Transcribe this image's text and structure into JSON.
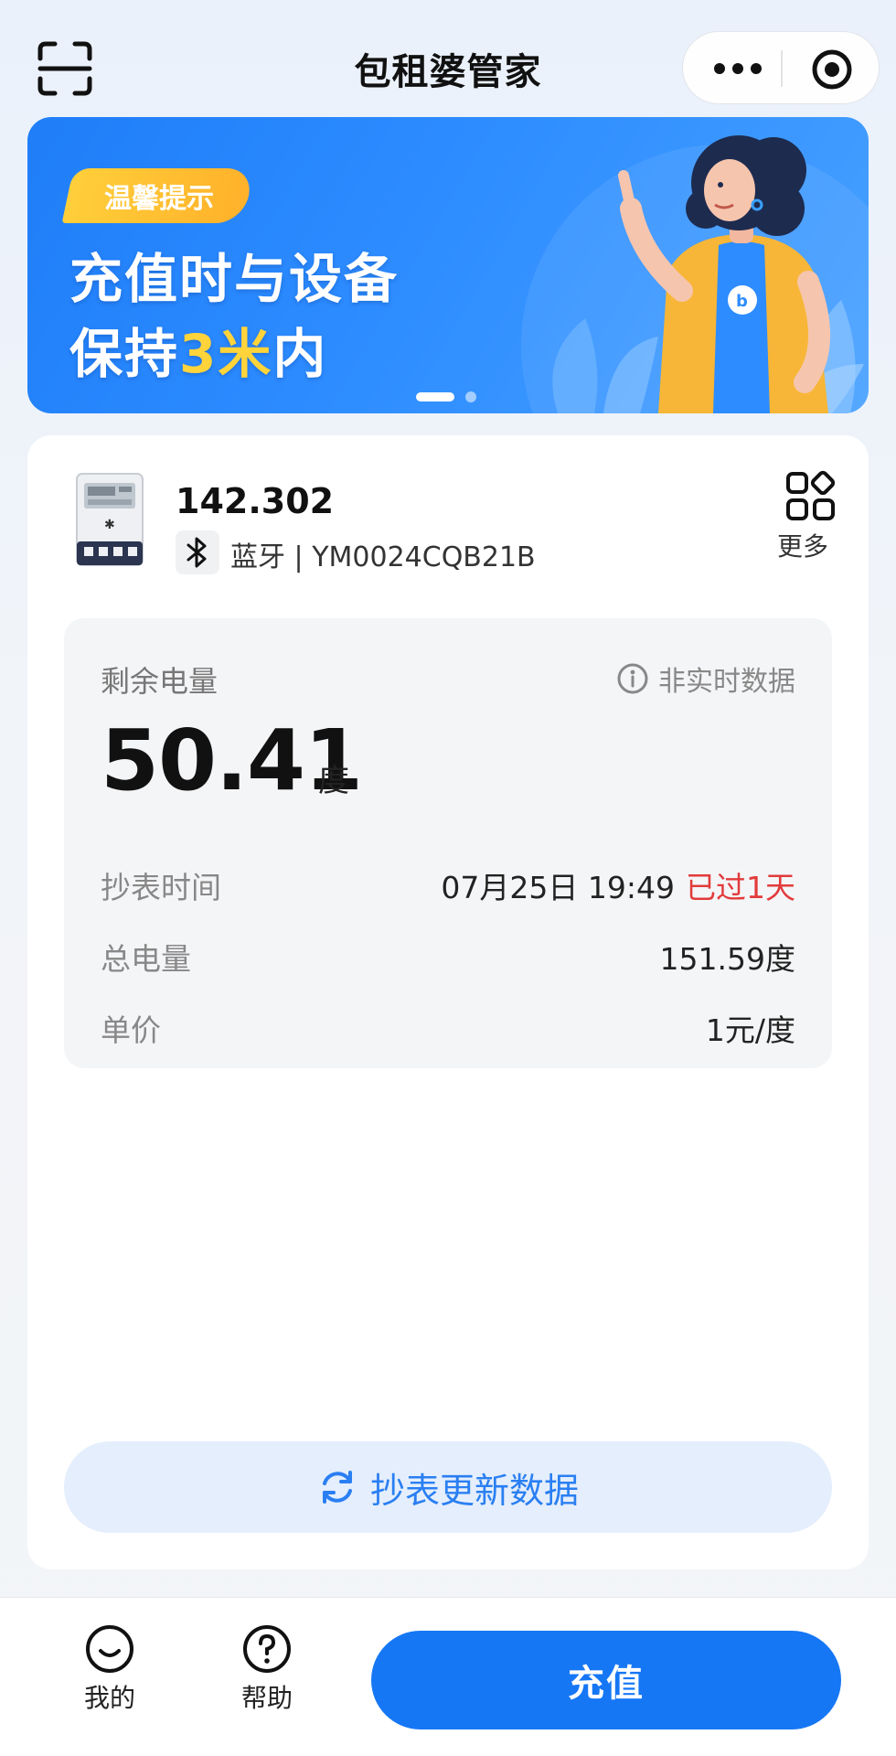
{
  "header": {
    "title": "包租婆管家"
  },
  "banner": {
    "tag": "温馨提示",
    "line1": "充值时与设备",
    "line2_prefix": "保持",
    "line2_highlight": "3米",
    "line2_suffix": "内"
  },
  "device": {
    "id": "142.302",
    "connection": "蓝牙",
    "separator": " | ",
    "serial": "YM0024CQB21B",
    "more_label": "更多"
  },
  "reading": {
    "remain_label": "剩余电量",
    "non_realtime": "非实时数据",
    "remain_value": "50.41",
    "remain_unit": "度",
    "rows": [
      {
        "label": "抄表时间",
        "value": "07月25日 19:49",
        "note": "已过1天"
      },
      {
        "label": "总电量",
        "value": "151.59度"
      },
      {
        "label": "单价",
        "value": "1元/度"
      }
    ]
  },
  "actions": {
    "update_label": "抄表更新数据",
    "recharge_label": "充值"
  },
  "bottom_nav": {
    "me_label": "我的",
    "help_label": "帮助"
  },
  "colors": {
    "primary": "#1677f5",
    "highlight": "#ffd43a",
    "overdue": "#e23b3b"
  }
}
